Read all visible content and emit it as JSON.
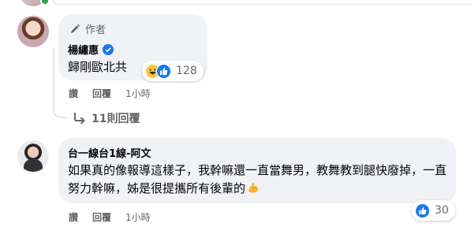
{
  "comment1": {
    "author_tag": "作者",
    "name": "楊繡惠",
    "text": "歸剛歐北共",
    "reaction_count": "128",
    "actions": {
      "like": "讚",
      "reply": "回覆",
      "time": "1小時"
    },
    "replies_label": "11則回覆"
  },
  "comment2": {
    "name": "台一線台1線-阿文",
    "text": "如果真的像報導這樣子，我幹嘛還一直當舞男，教舞教到腿快廢掉，一直努力幹嘛，姊是很提攜所有後輩的",
    "reaction_count": "30",
    "actions": {
      "like": "讚",
      "reply": "回覆",
      "time": "1小時"
    }
  },
  "colors": {
    "bubble": "#f0f2f5",
    "secondary_text": "#65676b",
    "accent_blue": "#1877f2",
    "haha_yellow": "#fcc83a"
  },
  "icons": [
    "pen-icon",
    "verified-badge-icon",
    "haha-reaction-icon",
    "like-reaction-icon",
    "reply-arrow-icon",
    "flexed-biceps-emoji"
  ]
}
